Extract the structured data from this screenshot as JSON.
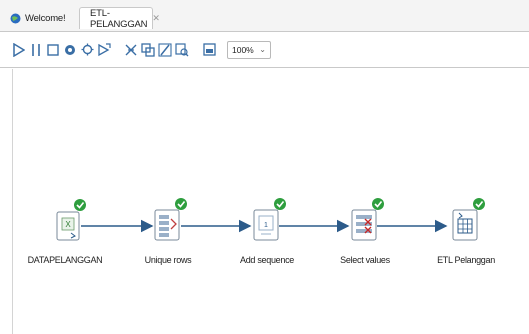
{
  "tabs": [
    {
      "label": "Welcome!",
      "active": false
    },
    {
      "label": "ETL-PELANGGAN",
      "active": true,
      "close": "✕"
    }
  ],
  "toolbar": {
    "zoom": "100%"
  },
  "steps": [
    {
      "label": "DATAPELANGGAN",
      "icon": "excel-input-icon"
    },
    {
      "label": "Unique rows",
      "icon": "unique-rows-icon"
    },
    {
      "label": "Add sequence",
      "icon": "add-sequence-icon"
    },
    {
      "label": "Select values",
      "icon": "select-values-icon"
    },
    {
      "label": "ETL Pelanggan",
      "icon": "table-output-icon"
    }
  ],
  "colors": {
    "accent": "#3a6ea5",
    "check": "#2e9e3e",
    "hop": "#2c5b8a"
  }
}
